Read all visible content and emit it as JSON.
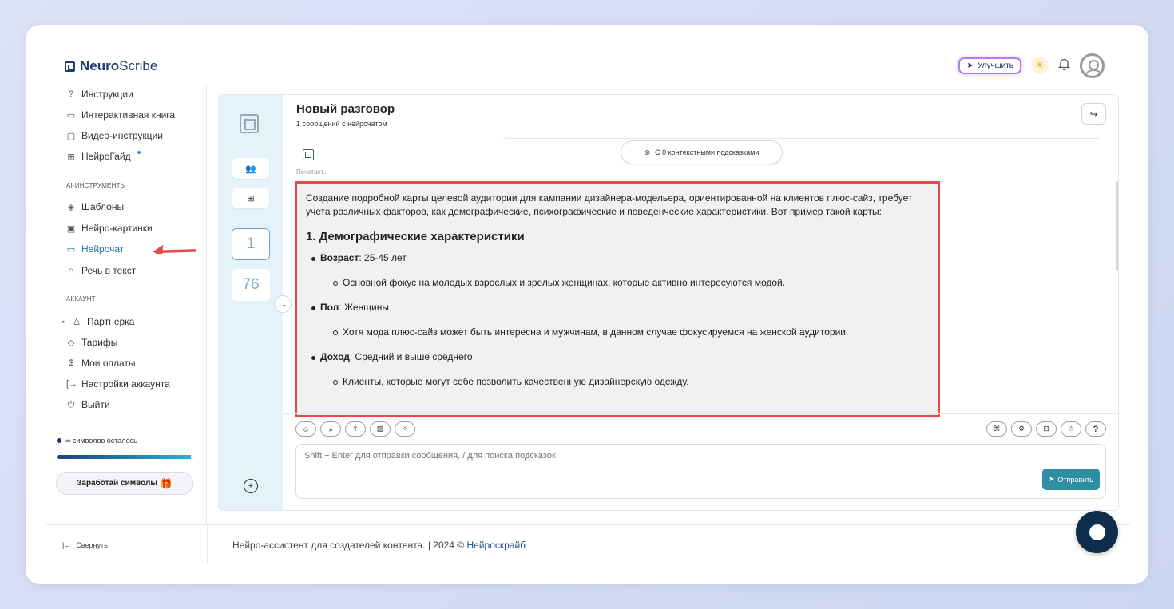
{
  "app": {
    "brand_bold": "Neuro",
    "brand_light": "Scribe"
  },
  "header": {
    "upgrade_label": "Улучшить"
  },
  "sidebar": {
    "items_top": [
      {
        "label": "Инструкции",
        "icon": "help-circle-icon"
      },
      {
        "label": "Интерактивная книга",
        "icon": "book-icon"
      },
      {
        "label": "Видео-инструкции",
        "icon": "video-icon"
      },
      {
        "label": "НейроГайд",
        "icon": "guide-icon"
      }
    ],
    "section_ai": "AI-ИНСТРУМЕНТЫ",
    "items_ai": [
      {
        "label": "Шаблоны",
        "icon": "layers-icon"
      },
      {
        "label": "Нейро-картинки",
        "icon": "image-icon"
      },
      {
        "label": "Нейрочат",
        "icon": "chat-icon"
      },
      {
        "label": "Речь в текст",
        "icon": "headphones-icon"
      }
    ],
    "section_account": "АККАУНТ",
    "items_account": [
      {
        "label": "Партнерка",
        "icon": "users-icon"
      },
      {
        "label": "Тарифы",
        "icon": "tag-icon"
      },
      {
        "label": "Мои оплаты",
        "icon": "dollar-icon"
      },
      {
        "label": "Настройки аккаунта",
        "icon": "login-icon"
      },
      {
        "label": "Выйти",
        "icon": "power-icon"
      }
    ],
    "symbols_left": "∞ символов осталось",
    "symbols_progress": 0.98,
    "earn_button": "Заработай символы"
  },
  "chat": {
    "title": "Новый разговор",
    "subtitle": "1 сообщений с нейрочатом",
    "typing": "Печатает...",
    "hints_pill": "С 0 контекстными подсказками",
    "rail_counts": [
      "1",
      "76"
    ],
    "response": {
      "intro": "Создание подробной карты целевой аудитории для кампании дизайнера-модельера, ориентированной на клиентов плюс-сайз, требует учета различных факторов, как демографические, психографические и поведенческие характеристики. Вот пример такой карты:",
      "heading": "1. Демографические характеристики",
      "items": [
        {
          "label": "Возраст",
          "value": ": 25-45 лет",
          "sub": "Основной фокус на молодых взрослых и зрелых женщинах, которые активно интересуются модой."
        },
        {
          "label": "Пол",
          "value": ": Женщины",
          "sub": "Хотя мода плюс-сайз может быть интересна и мужчинам, в данном случае фокусируемся на женской аудитории."
        },
        {
          "label": "Доход",
          "value": ": Средний и выше среднего",
          "sub": "Клиенты, которые могут себе позволить качественную дизайнерскую одежду."
        }
      ]
    },
    "input_placeholder": "Shift + Enter для отправки сообщения, / для поиска подсказок",
    "send_label": "Отправить"
  },
  "footer": {
    "collapse_label": "Свернуть",
    "text": "Нейро-ассистент для создателей контента.  | 2024 © ",
    "link": "Нейроскрайб"
  },
  "colors": {
    "highlight_border": "#e54848",
    "accent": "#2e8fa3",
    "brand": "#1f3f6a"
  }
}
